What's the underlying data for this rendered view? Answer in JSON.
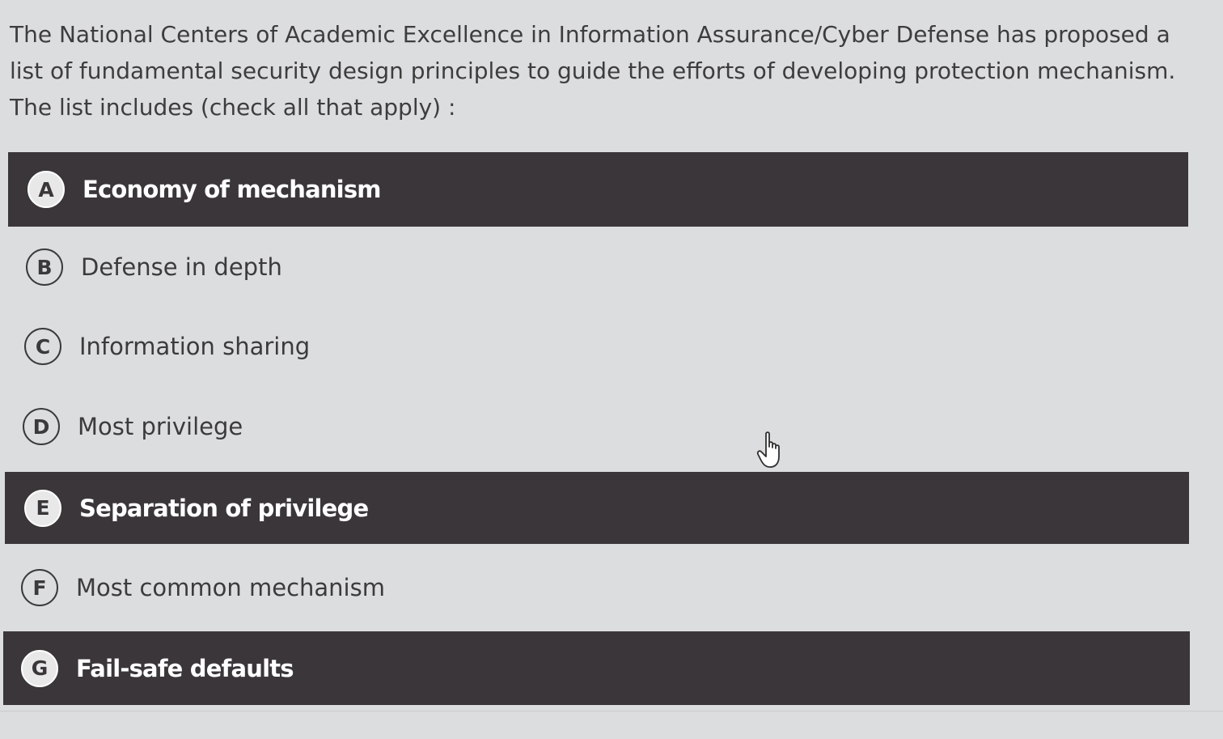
{
  "question": {
    "text": "The National Centers of Academic Excellence in Information Assurance/Cyber Defense has proposed a list of fundamental security design principles to guide the efforts of developing protection mechanism. The list includes (check all that apply) :"
  },
  "options": [
    {
      "letter": "A",
      "label": "Economy of mechanism",
      "selected": true
    },
    {
      "letter": "B",
      "label": "Defense in depth",
      "selected": false
    },
    {
      "letter": "C",
      "label": "Information sharing",
      "selected": false
    },
    {
      "letter": "D",
      "label": "Most privilege",
      "selected": false
    },
    {
      "letter": "E",
      "label": "Separation of privilege",
      "selected": true
    },
    {
      "letter": "F",
      "label": "Most common mechanism",
      "selected": false
    },
    {
      "letter": "G",
      "label": "Fail-safe defaults",
      "selected": true
    }
  ],
  "cursor": {
    "icon": "hand-pointer-icon"
  },
  "colors": {
    "selected_background": "#3a3639",
    "page_background": "#dcdddf"
  }
}
